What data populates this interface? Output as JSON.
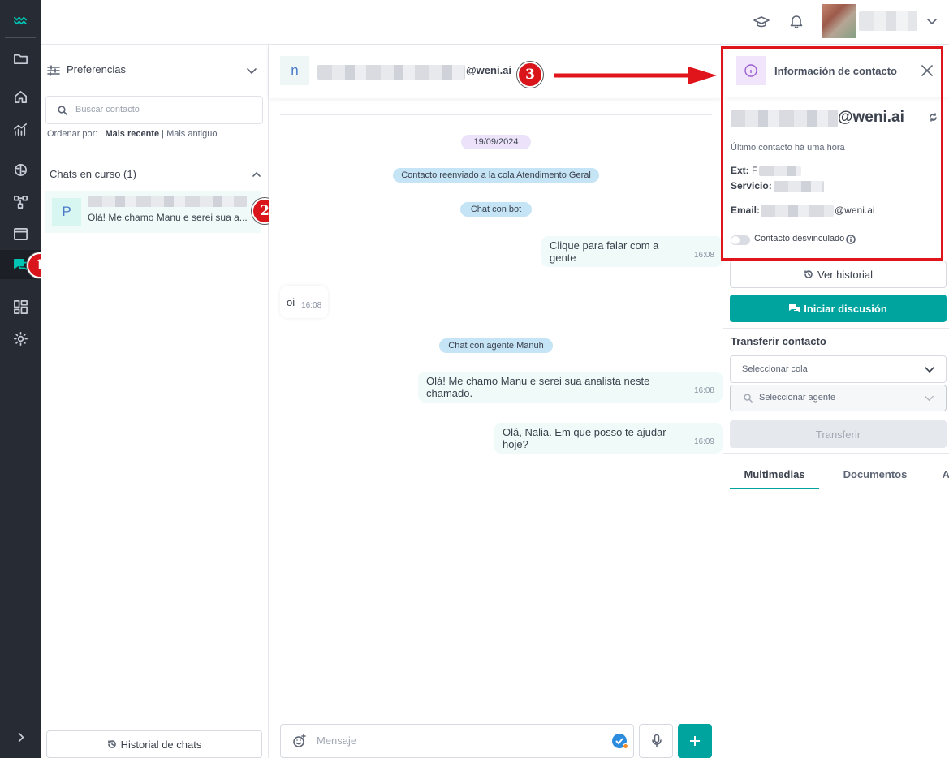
{
  "list": {
    "preferences_label": "Preferencias",
    "search_placeholder": "Buscar contacto",
    "sort_label": "Ordenar por:",
    "sort_recent": "Mais recente",
    "sort_separator": "|",
    "sort_oldest": "Mais antiguo",
    "section_title": "Chats en curso (1)",
    "chat_item": {
      "avatar_letter": "P",
      "preview": "Olá! Me chamo Manu e serei sua a..."
    },
    "history_button": "Historial de chats"
  },
  "conversation": {
    "avatar_letter": "n",
    "contact_domain": "@weni.ai",
    "messages": [
      {
        "type": "date",
        "text": "19/09/2024"
      },
      {
        "type": "event",
        "text": "Contacto reenviado a la cola Atendimento Geral"
      },
      {
        "type": "event",
        "text": "Chat con bot"
      },
      {
        "type": "out",
        "text": "Clique para falar com a gente",
        "time": "16:08"
      },
      {
        "type": "in",
        "text": "oi",
        "time": "16:08"
      },
      {
        "type": "event",
        "text": "Chat con agente Manuh"
      },
      {
        "type": "out",
        "text": "Olá! Me chamo Manu e serei sua analista neste chamado.",
        "time": "16:08"
      },
      {
        "type": "out",
        "text": "Olá, Nalia. Em que posso te ajudar hoje?",
        "time": "16:09"
      }
    ],
    "input_placeholder": "Mensaje"
  },
  "contact": {
    "title": "Información de contacto",
    "domain": "@weni.ai",
    "last_contact": "Último contacto há uma hora",
    "ext_label": "Ext:",
    "ext_value_prefix": "F",
    "service_label": "Servicio:",
    "email_label": "Email:",
    "email_domain": "@weni.ai",
    "unlinked_label": "Contacto desvinculado",
    "history_button": "Ver historial",
    "start_discussion_button": "Iniciar discusión",
    "transfer_title": "Transferir contacto",
    "queue_placeholder": "Seleccionar cola",
    "agent_placeholder": "Seleccionar agente",
    "transfer_button": "Transferir",
    "tabs": [
      "Multimedias",
      "Documentos",
      "A"
    ]
  },
  "annotations": {
    "badge_1": "1",
    "badge_2": "2",
    "badge_3": "3"
  },
  "colors": {
    "accent": "#00a49f",
    "rail": "#272b33",
    "highlight_box": "#e0141b",
    "bubble_out": "#f0fbf9",
    "event_pill": "#c5e4f5",
    "date_pill": "#ece3fb"
  }
}
